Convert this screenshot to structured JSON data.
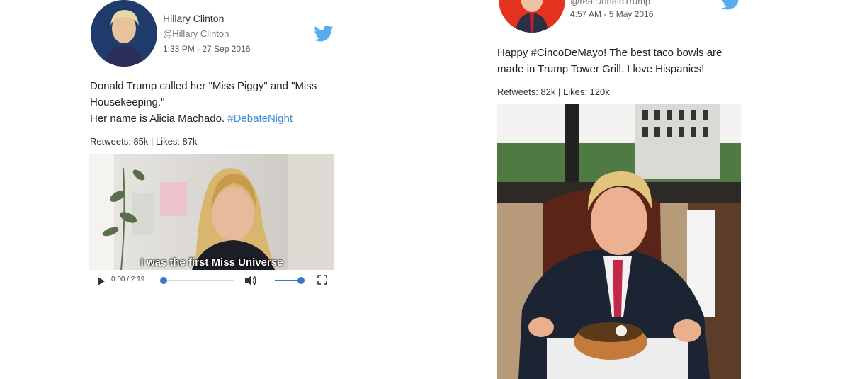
{
  "tweets": [
    {
      "name": "Hillary Clinton",
      "handle": "@Hillary Clinton",
      "timestamp": "1:33 PM - 27 Sep 2016",
      "text_line1": "Donald Trump called her \"Miss Piggy\" and \"Miss",
      "text_line2": "Housekeeping.\"",
      "text_line3_plain": "Her name is Alicia Machado. ",
      "hashtag": "#DebateNight",
      "stats": "Retweets: 85k | Likes: 87k",
      "avatar_color": "#1f3b6b",
      "video": {
        "subtitle": "I was the first Miss Universe",
        "time": "0:00 / 2:19",
        "progress": 0.0,
        "volume": 0.9
      }
    },
    {
      "handle": "@realDonaldTrump",
      "timestamp": "4:57 AM - 5 May 2016",
      "text_line1_plain": "Happy ",
      "text_line1_hashtag": "#CincoDeMayo",
      "text_line1_rest": "! The best taco bowls are",
      "text_line2": "made in Trump Tower Grill. I love Hispanics!",
      "stats": "Retweets: 82k | Likes: 120k",
      "avatar_color": "#e3321f"
    }
  ],
  "colors": {
    "twitter_blue": "#55acee",
    "link": "#3b8ed9",
    "slider": "#3b76c9"
  },
  "icons": [
    "twitter-bird-icon",
    "play-icon",
    "volume-icon",
    "fullscreen-icon"
  ]
}
